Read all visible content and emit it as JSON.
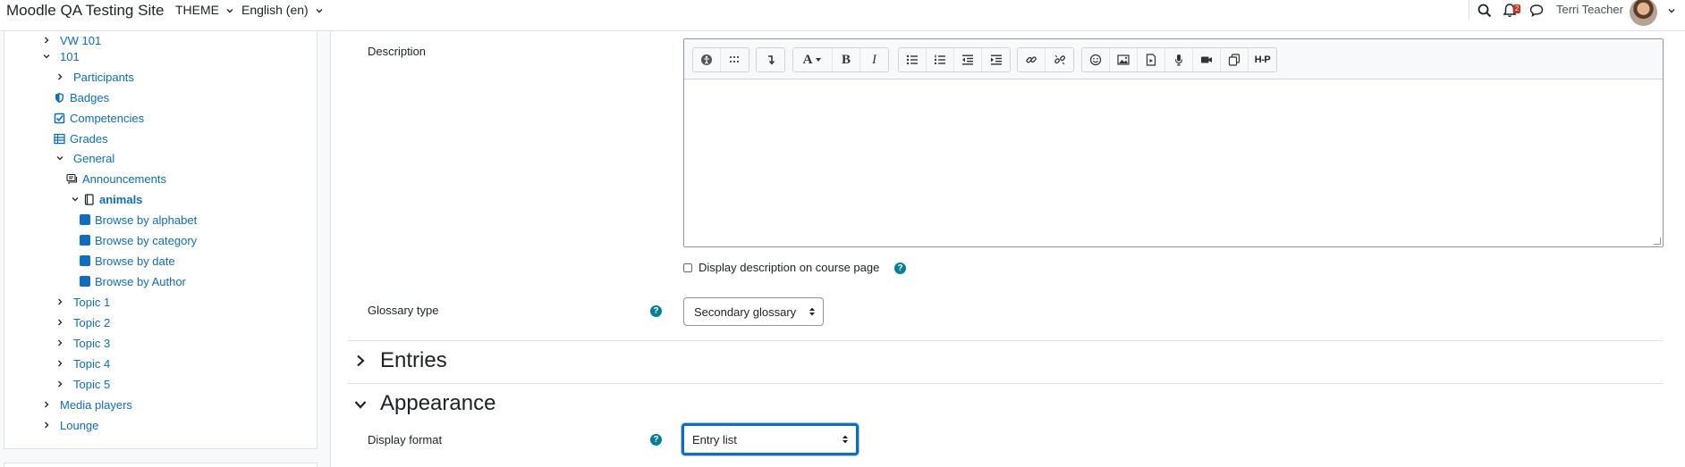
{
  "navbar": {
    "site_name": "Moodle QA Testing Site",
    "theme_menu": "THEME",
    "language_menu": "English (en)",
    "notification_count": "2",
    "user_name": "Terri Teacher"
  },
  "sidebar": {
    "items": [
      {
        "label": "VW 101"
      },
      {
        "label": "101"
      },
      {
        "label": "Participants"
      },
      {
        "label": "Badges"
      },
      {
        "label": "Competencies"
      },
      {
        "label": "Grades"
      },
      {
        "label": "General"
      },
      {
        "label": "Announcements"
      },
      {
        "label": "animals"
      },
      {
        "label": "Browse by alphabet"
      },
      {
        "label": "Browse by category"
      },
      {
        "label": "Browse by date"
      },
      {
        "label": "Browse by Author"
      },
      {
        "label": "Topic 1"
      },
      {
        "label": "Topic 2"
      },
      {
        "label": "Topic 3"
      },
      {
        "label": "Topic 4"
      },
      {
        "label": "Topic 5"
      },
      {
        "label": "Media players"
      },
      {
        "label": "Lounge"
      }
    ]
  },
  "form": {
    "description_label": "Description",
    "editor_toolbar": {
      "bold": "B",
      "italic": "I",
      "font": "A",
      "h5p": "H-P"
    },
    "display_description_label": "Display description on course page",
    "glossary_type_label": "Glossary type",
    "glossary_type_value": "Secondary glossary",
    "entries_section": "Entries",
    "appearance_section": "Appearance",
    "display_format_label": "Display format",
    "display_format_value": "Entry list"
  },
  "colors": {
    "link": "#0f6cbf",
    "help_icon": "#008196",
    "focus_border": "#0f6cbf"
  }
}
